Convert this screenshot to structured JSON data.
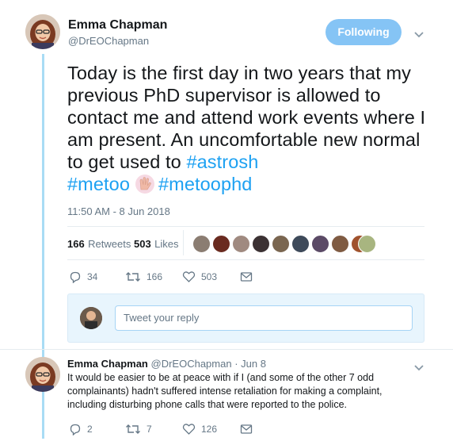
{
  "author": {
    "name": "Emma Chapman",
    "handle": "@DrEOChapman",
    "follow_label": "Following"
  },
  "tweet": {
    "text_plain": "Today is the first day in two years that my previous PhD supervisor is allowed to contact me and attend work events where I am present. An uncomfortable new normal to get used to ",
    "hashtag1": "#astrosh",
    "hashtag2": "#metoo",
    "hashtag3": "#metoophd",
    "emoji_name": "raised-hands-emoji",
    "timestamp": "11:50 AM - 8 Jun 2018"
  },
  "stats": {
    "retweets_count": "166",
    "retweets_label": "Retweets",
    "likes_count": "503",
    "likes_label": "Likes",
    "liker_avatar_count": 10
  },
  "actions": {
    "reply_count": "34",
    "retweet_count": "166",
    "like_count": "503"
  },
  "reply_box": {
    "placeholder": "Tweet your reply"
  },
  "reply": {
    "name": "Emma Chapman",
    "handle": "@DrEOChapman",
    "separator": "·",
    "date": "Jun 8",
    "text": "It would be easier to be at peace with if I (and some of the other 7 odd complainants) hadn't suffered intense retaliation for making a complaint, including disturbing phone calls that were reported to the police.",
    "reply_count": "2",
    "retweet_count": "7",
    "like_count": "126"
  },
  "colors": {
    "accent": "#1da1f2",
    "follow_bg": "#85c4f5",
    "thread_line": "#a9dcf5",
    "muted": "#657786"
  }
}
